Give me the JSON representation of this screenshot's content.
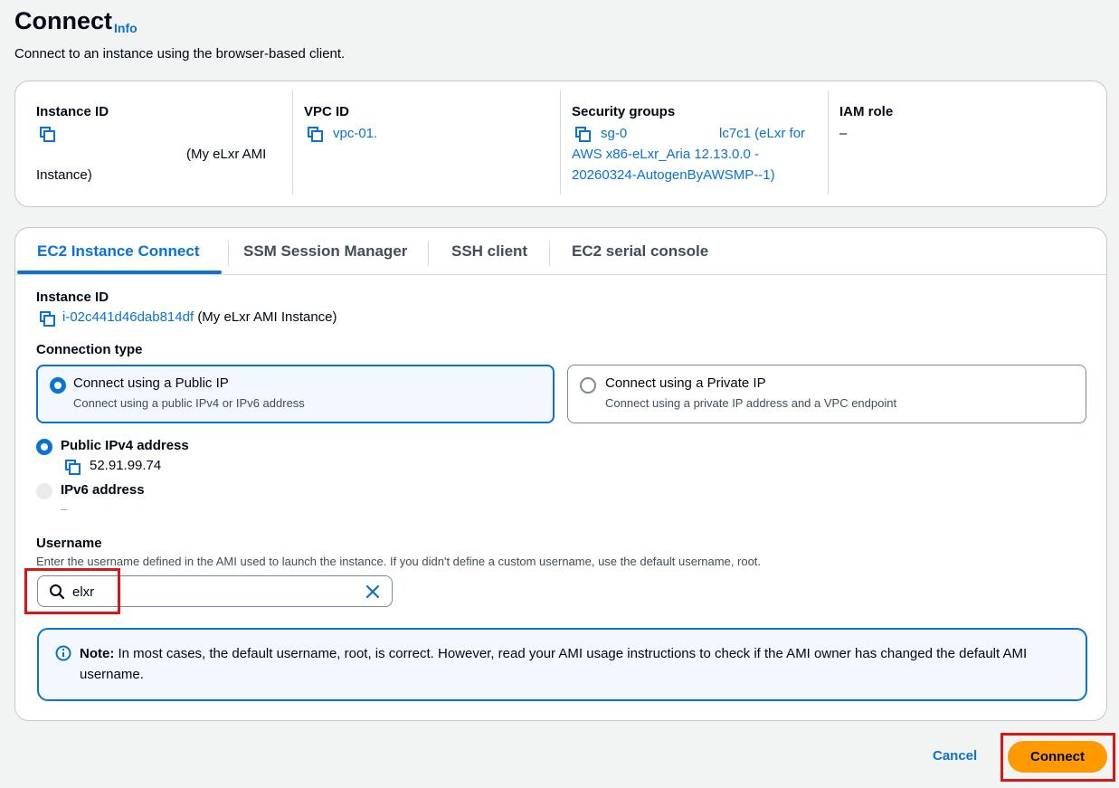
{
  "header": {
    "title": "Connect",
    "info": "Info",
    "subtitle": "Connect to an instance using the browser-based client."
  },
  "summary": {
    "instance_id": {
      "label": "Instance ID",
      "name_suffix": "(My eLxr AMI",
      "name_suffix2": "Instance)"
    },
    "vpc_id": {
      "label": "VPC ID",
      "value": "vpc-01."
    },
    "security_groups": {
      "label": "Security groups",
      "value_line1_a": "sg-0",
      "value_line1_b": "lc7c1 (eLxr for",
      "value_line2": "AWS x86-eLxr_Aria 12.13.0.0 -",
      "value_line3": "20260324-AutogenByAWSMP--1)"
    },
    "iam_role": {
      "label": "IAM role",
      "value": "–"
    }
  },
  "tabs": [
    {
      "label": "EC2 Instance Connect",
      "active": true
    },
    {
      "label": "SSM Session Manager",
      "active": false
    },
    {
      "label": "SSH client",
      "active": false
    },
    {
      "label": "EC2 serial console",
      "active": false
    }
  ],
  "form": {
    "instance_label": "Instance ID",
    "instance_id": "i-02c441d46dab814df",
    "instance_name": "(My eLxr AMI Instance)",
    "connection_type_label": "Connection type",
    "public_tile": {
      "title": "Connect using a Public IP",
      "desc": "Connect using a public IPv4 or IPv6 address",
      "selected": true
    },
    "private_tile": {
      "title": "Connect using a Private IP",
      "desc": "Connect using a private IP address and a VPC endpoint",
      "selected": false
    },
    "ipv4_label": "Public IPv4 address",
    "ipv4_value": "52.91.99.74",
    "ipv6_label": "IPv6 address",
    "ipv6_value": "–",
    "username_label": "Username",
    "username_help": "Enter the username defined in the AMI used to launch the instance. If you didn't define a custom username, use the default username, root.",
    "username_value": "elxr",
    "note_bold": "Note:",
    "note_text": "In most cases, the default username, root, is correct. However, read your AMI usage instructions to check if the AMI owner has changed the default AMI username."
  },
  "footer": {
    "cancel": "Cancel",
    "connect": "Connect"
  },
  "colors": {
    "link": "#0972d3",
    "primary_button": "#ff9900",
    "highlight": "#d91515"
  }
}
